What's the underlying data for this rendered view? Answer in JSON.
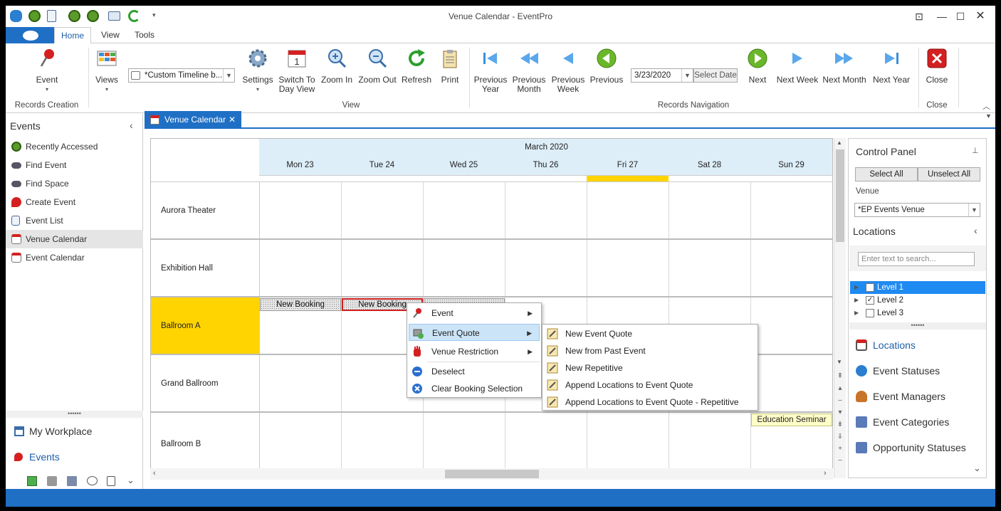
{
  "window": {
    "title": "Venue Calendar - EventPro"
  },
  "ribbon_tabs": [
    "Home",
    "View",
    "Tools"
  ],
  "ribbon": {
    "event_btn": "Event",
    "group_records_creation": "Records Creation",
    "views_btn": "Views",
    "timeline_combo": "*Custom Timeline b...",
    "settings_btn": "Settings",
    "switch_line1": "Switch To",
    "switch_line2": "Day View",
    "zoom_in": "Zoom In",
    "zoom_out": "Zoom Out",
    "refresh": "Refresh",
    "print": "Print",
    "group_view": "View",
    "prev_year_1": "Previous",
    "prev_year_2": "Year",
    "prev_month_1": "Previous",
    "prev_month_2": "Month",
    "prev_week_1": "Previous",
    "prev_week_2": "Week",
    "previous": "Previous",
    "date_value": "3/23/2020",
    "select_date": "Select Date",
    "next": "Next",
    "next_week": "Next Week",
    "next_month": "Next Month",
    "next_year": "Next Year",
    "group_records_navigation": "Records Navigation",
    "close_btn": "Close",
    "group_close": "Close"
  },
  "sidebar": {
    "header": "Events",
    "items": [
      {
        "label": "Recently Accessed",
        "icon": "clock-icon"
      },
      {
        "label": "Find Event",
        "icon": "binoculars-icon"
      },
      {
        "label": "Find Space",
        "icon": "binoculars-icon"
      },
      {
        "label": "Create Event",
        "icon": "pushpin-icon"
      },
      {
        "label": "Event List",
        "icon": "document-icon"
      },
      {
        "label": "Venue Calendar",
        "icon": "calendar-icon"
      },
      {
        "label": "Event Calendar",
        "icon": "calendar-icon"
      }
    ],
    "my_workplace": "My Workplace",
    "events": "Events"
  },
  "doc_tab": {
    "label": "Venue Calendar"
  },
  "calendar": {
    "month": "March 2020",
    "days": [
      "Mon 23",
      "Tue 24",
      "Wed 25",
      "Thu 26",
      "Fri 27",
      "Sat 28",
      "Sun 29"
    ],
    "venues": [
      "Aurora Theater",
      "Exhibition Hall",
      "Ballroom A",
      "Grand Ballroom",
      "Ballroom B"
    ],
    "bookings": [
      "New Booking",
      "New Booking"
    ],
    "seminar": "Education Seminar"
  },
  "control_panel": {
    "title": "Control Panel",
    "select_all": "Select All",
    "unselect_all": "Unselect All",
    "venue_label": "Venue",
    "venue_value": "*EP Events Venue",
    "locations_header": "Locations",
    "search_placeholder": "Enter text to search...",
    "levels": [
      "Level 1",
      "Level 2",
      "Level 3"
    ],
    "nav": [
      "Locations",
      "Event Statuses",
      "Event Managers",
      "Event Categories",
      "Opportunity Statuses"
    ]
  },
  "context_menu": {
    "items": [
      "Event",
      "Event Quote",
      "Venue Restriction",
      "Deselect",
      "Clear Booking Selection"
    ]
  },
  "submenu": {
    "items": [
      "New Event Quote",
      "New from Past Event",
      "New Repetitive",
      "Append Locations to Event Quote",
      "Append Locations to Event Quote - Repetitive"
    ]
  },
  "colors": {
    "accent": "#1f6fc5",
    "highlight": "#ffd400",
    "menu_selected": "#cce4f7"
  }
}
